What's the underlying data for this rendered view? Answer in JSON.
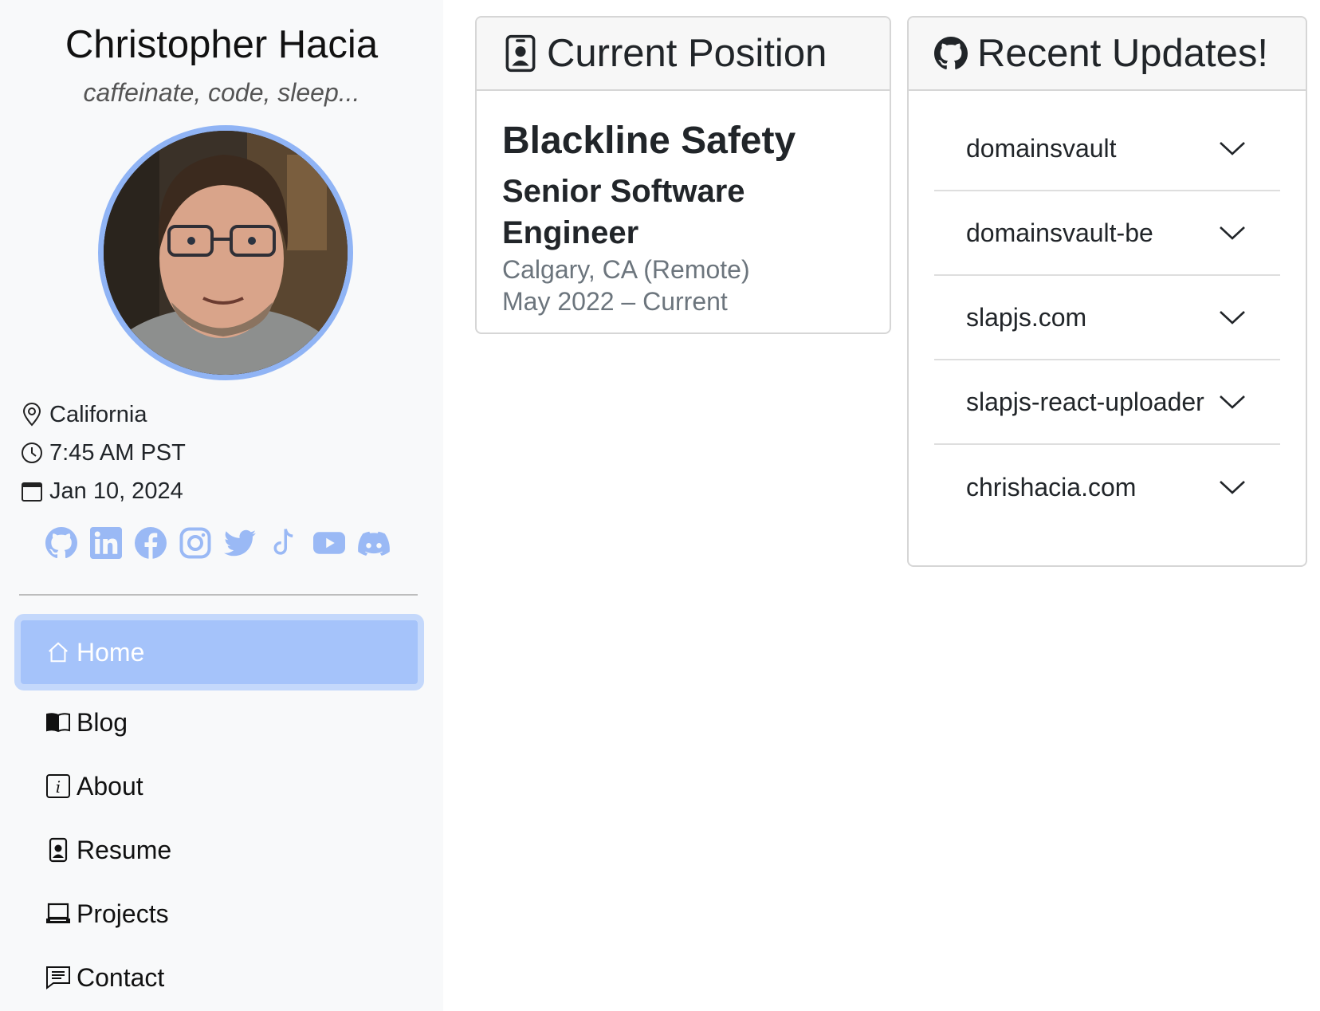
{
  "profile": {
    "name": "Christopher Hacia",
    "tagline": "caffeinate, code, sleep..."
  },
  "info": {
    "location": "California",
    "time": "7:45 AM PST",
    "date": "Jan 10, 2024"
  },
  "social_icons": [
    "github-icon",
    "linkedin-icon",
    "facebook-icon",
    "instagram-icon",
    "twitter-icon",
    "tiktok-icon",
    "youtube-icon",
    "discord-icon"
  ],
  "nav": {
    "items": [
      {
        "label": "Home",
        "icon": "house-icon",
        "active": true
      },
      {
        "label": "Blog",
        "icon": "book-icon"
      },
      {
        "label": "About",
        "icon": "info-icon"
      },
      {
        "label": "Resume",
        "icon": "person-badge-icon"
      },
      {
        "label": "Projects",
        "icon": "laptop-icon"
      },
      {
        "label": "Contact",
        "icon": "chat-icon"
      }
    ]
  },
  "position_card": {
    "title": "Current Position",
    "company": "Blackline Safety",
    "role": "Senior Software Engineer",
    "location": "Calgary, CA (Remote)",
    "dates": "May 2022 – Current"
  },
  "updates_card": {
    "title": "Recent Updates!",
    "items": [
      {
        "label": "domainsvault"
      },
      {
        "label": "domainsvault-be"
      },
      {
        "label": "slapjs.com"
      },
      {
        "label": "slapjs-react-uploader"
      },
      {
        "label": "chrishacia.com"
      }
    ]
  },
  "colors": {
    "accent": "#90b4f5",
    "active_nav": "#a5c3fa",
    "social": "#9ab9f5"
  }
}
